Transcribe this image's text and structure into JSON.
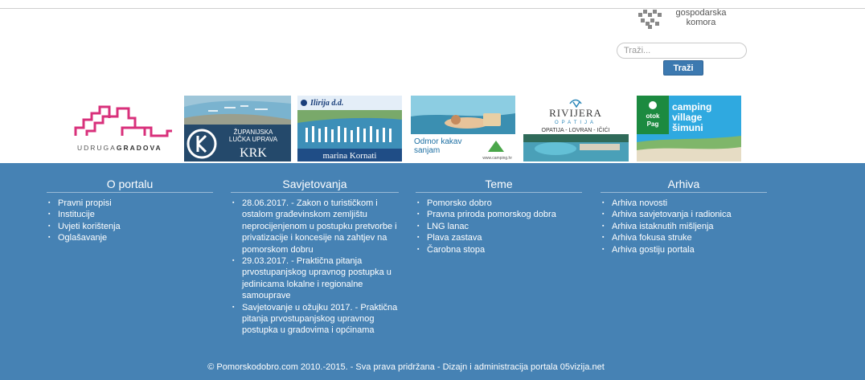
{
  "header": {
    "chamber_line1": "gospodarska",
    "chamber_line2": "komora",
    "search_placeholder": "Traži...",
    "search_button": "Traži"
  },
  "banners": {
    "udruga": {
      "prefix": "UDRUGA",
      "suffix": "GRADOVA"
    },
    "krk": {
      "line1": "ŽUPANIJSKA",
      "line2": "LUČKA UPRAVA",
      "name": "KRK"
    },
    "ilirija": {
      "brand": "Ilirija d.d.",
      "caption": "marina Kornati"
    },
    "camping": {
      "line1": "Odmor kakav",
      "line2": "sanjam",
      "url": "www.camping.hr"
    },
    "rivijera": {
      "title": "RIVIJERA",
      "subtitle": "OPATIJA",
      "places": "OPATIJA - LOVRAN - IČIĆI"
    },
    "simuni": {
      "line1": "camping",
      "line2": "village",
      "line3": "šimuni",
      "island1": "otok",
      "island2": "Pag"
    }
  },
  "footer": {
    "o_portalu": {
      "title": "O portalu",
      "items": [
        "Pravni propisi",
        "Institucije",
        "Uvjeti korištenja",
        "Oglašavanje"
      ]
    },
    "savjetovanja": {
      "title": "Savjetovanja",
      "items": [
        "28.06.2017. - Zakon o turističkom i ostalom građevinskom zemljištu neprocijenjenom u postupku pretvorbe i privatizacije i koncesije na zahtjev na pomorskom dobru",
        "29.03.2017. - Praktična pitanja prvostupanjskog upravnog postupka u jedinicama lokalne i regionalne samouprave",
        "Savjetovanje u ožujku 2017. - Praktična pitanja prvostupanjskog upravnog postupka u gradovima i općinama"
      ]
    },
    "teme": {
      "title": "Teme",
      "items": [
        "Pomorsko dobro",
        "Pravna priroda pomorskog dobra",
        "LNG lanac",
        "Plava zastava",
        "Čarobna stopa"
      ]
    },
    "arhiva": {
      "title": "Arhiva",
      "items": [
        "Arhiva novosti",
        "Arhiva savjetovanja i radionica",
        "Arhiva istaknutih mišljenja",
        "Arhiva fokusa struke",
        "Arhiva gostiju portala"
      ]
    },
    "copyright": "© Pomorskodobro.com 2010.-2015. - Sva prava pridržana - Dizajn i administracija portala 05vizija.net"
  },
  "colors": {
    "footer_bg": "#4682b4",
    "button_bg": "#3c79b0",
    "udruga_pink": "#d8307b"
  }
}
